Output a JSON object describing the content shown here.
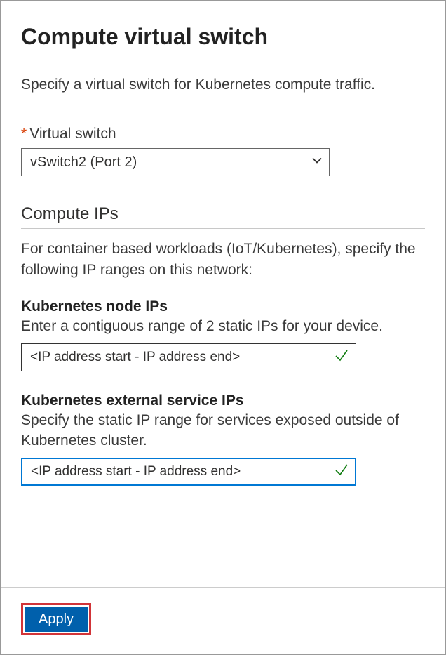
{
  "header": {
    "title": "Compute virtual switch",
    "description": "Specify a virtual switch for Kubernetes compute traffic."
  },
  "virtual_switch": {
    "required_mark": "*",
    "label": "Virtual switch",
    "selected": "vSwitch2 (Port 2)"
  },
  "compute_ips": {
    "heading": "Compute IPs",
    "description": "For container based workloads (IoT/Kubernetes), specify the following IP ranges on this network:"
  },
  "node_ips": {
    "heading": "Kubernetes node IPs",
    "description": "Enter a contiguous range of 2 static IPs for your device.",
    "placeholder": "<IP address start - IP address end>",
    "value": "<IP address start - IP address end>"
  },
  "service_ips": {
    "heading": "Kubernetes external service IPs",
    "description": "Specify the static IP range for services exposed outside of Kubernetes cluster.",
    "placeholder": "<IP address start - IP address end>",
    "value": "<IP address start - IP address end>"
  },
  "footer": {
    "apply_label": "Apply"
  }
}
